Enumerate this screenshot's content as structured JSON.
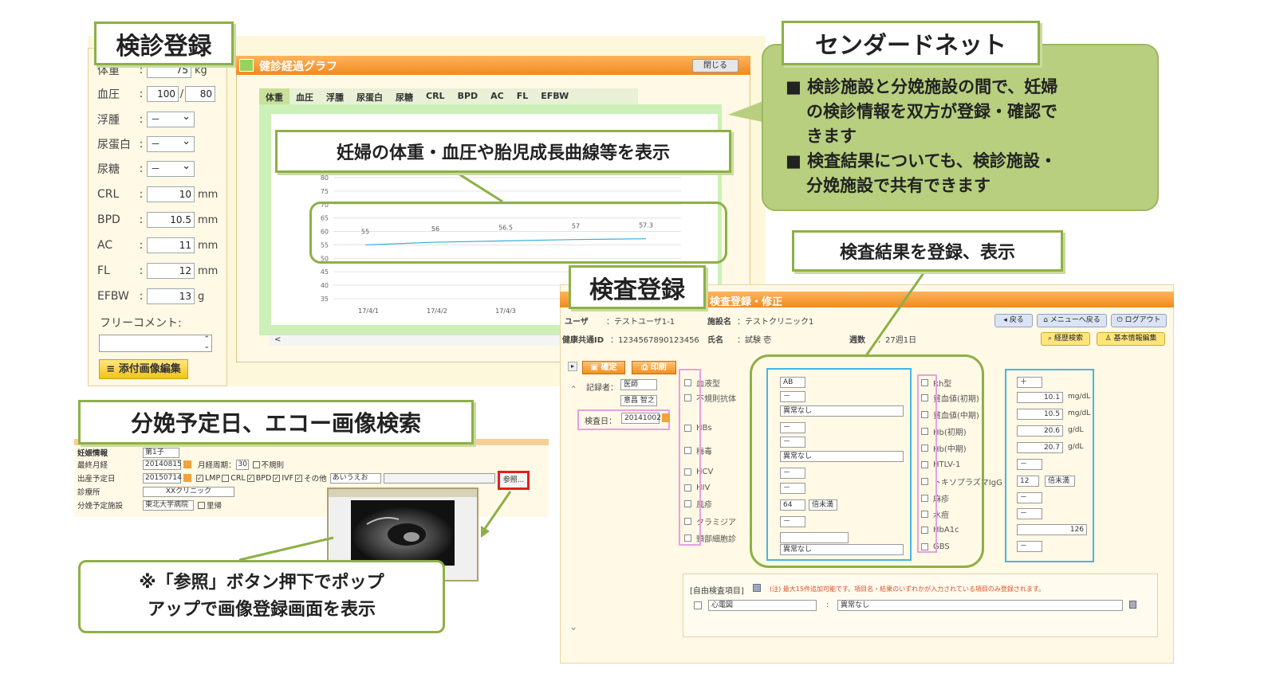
{
  "labels": {
    "exam_registration": "検診登録",
    "sender_net": "センダードネット",
    "delivery_search": "分娩予定日、エコー画像検索",
    "test_registration": "検査登録",
    "test_result_callout": "検査結果を登録、表示",
    "graph_callout": "妊婦の体重・血圧や胎児成長曲線等を表示",
    "popup_callout_line1": "※「参照」ボタン押下でポップ",
    "popup_callout_line2": "アップで画像登録画面を表示"
  },
  "sender_bubble": {
    "bullet1_line1": "■ 検診施設と分娩施設の間で、妊婦",
    "bullet1_line2": "の検診情報を双方が登録・確認で",
    "bullet1_line3": "きます",
    "bullet2_line1": "■ 検査結果についても、検診施設・",
    "bullet2_line2": "分娩施設で共有できます"
  },
  "exam_form": {
    "weight_label": "体重",
    "weight_value": "75",
    "weight_unit": "kg",
    "bp_label": "血圧",
    "bp_high": "100",
    "bp_sep": "/",
    "bp_low": "80",
    "edema_label": "浮腫",
    "edema_value": "－",
    "urine_protein_label": "尿蛋白",
    "urine_protein_value": "－",
    "urine_sugar_label": "尿糖",
    "urine_sugar_value": "－",
    "crl_label": "CRL",
    "crl_value": "10",
    "crl_unit": "mm",
    "bpd_label": "BPD",
    "bpd_value": "10.5",
    "bpd_unit": "mm",
    "ac_label": "AC",
    "ac_value": "11",
    "ac_unit": "mm",
    "fl_label": "FL",
    "fl_value": "12",
    "fl_unit": "mm",
    "efbw_label": "EFBW",
    "efbw_value": "13",
    "efbw_unit": "g",
    "colon": ":",
    "comment_label": "フリーコメント:",
    "attach_button": "添付画像編集"
  },
  "graph_window": {
    "title": "健診経過グラフ",
    "close_button": "閉じる",
    "tabs": [
      "体重",
      "血圧",
      "浮腫",
      "尿蛋白",
      "尿糖",
      "CRL",
      "BPD",
      "AC",
      "FL",
      "EFBW"
    ],
    "scroll_left": "<"
  },
  "chart_data": {
    "type": "line",
    "x": [
      "17/4/1",
      "17/4/2",
      "17/4/3"
    ],
    "series": [
      {
        "values": [
          55,
          56,
          56.5,
          57,
          57.3
        ]
      }
    ],
    "point_labels": [
      "55",
      "56",
      "56.5",
      "57",
      "57.3"
    ],
    "y_ticks": [
      35,
      40,
      45,
      50,
      55,
      60,
      65,
      70,
      75,
      80
    ],
    "ylim": [
      35,
      80
    ],
    "grid": true,
    "line_color": "#3aaed8"
  },
  "delivery_form": {
    "section_label": "妊娠情報",
    "section_value": "第1子",
    "lmp_label": "最終月経",
    "lmp_value": "20140815",
    "cycle_label": "月経周期：",
    "cycle_value": "30",
    "irregular_label": "不規則",
    "due_label": "出産予定日",
    "due_value": "20150714",
    "method_lmp": "LMP",
    "method_crl": "CRL",
    "method_bpd": "BPD",
    "method_ivf": "IVF",
    "method_other": "その他",
    "other_value": "あいうえお",
    "clinic_label": "診療所",
    "clinic_value": "XXクリニック",
    "facility_label": "分娩予定施設",
    "facility_value": "東北大学病院",
    "home_label": "里帰",
    "ref_button": "参照..."
  },
  "test_form": {
    "title": "検査登録・修正",
    "user_label": "ユーザ",
    "user_value": "：テストユーザ1-1",
    "facility_label": "施設名",
    "facility_value": "：テストクリニック1",
    "id_label": "健康共通ID",
    "id_value": "：1234567890123456",
    "name_label": "氏名",
    "name_value": "：試験 壱",
    "weeks_label": "週数",
    "weeks_value": "：27週1日",
    "btn_back": "戻る",
    "btn_menu": "メニューへ戻る",
    "btn_logout": "ログアウト",
    "btn_history": "経歴検索",
    "btn_basic": "基本情報編集",
    "btn_confirm": "確定",
    "btn_print": "印刷",
    "recorder_label": "記録者：",
    "recorder_role": "医師",
    "recorder_name": "意昌 智之",
    "date_label": "検査日：",
    "date_value": "20141002",
    "left_items": [
      "血液型",
      "不規則抗体",
      "HBs",
      "梅毒",
      "HCV",
      "HIV",
      "風疹",
      "クラミジア",
      "頸部細胞診"
    ],
    "right_items": [
      "Rh型",
      "貧血値(初期)",
      "貧血値(中期)",
      "Hb(初期)",
      "Hb(中期)",
      "HTLV-1",
      "トキソプラズマIgG",
      "麻疹",
      "水痘",
      "HbA1c",
      "GBS"
    ],
    "blood_type": "AB",
    "dash": "－",
    "abnormal_none": "異常なし",
    "rubella_value": "64",
    "rubella_unit": "倍未満",
    "rh_value": "＋",
    "anemia_early": "10.1",
    "anemia_mid": "10.5",
    "hb_early": "20.6",
    "hb_mid": "20.7",
    "toxo_value": "12",
    "toxo_unit": "倍未満",
    "hba1c_value": "126",
    "unit_mgdl": "mg/dL",
    "unit_gdl": "g/dL",
    "free_label": "[自由検査項目]",
    "free_note": "(注) 最大15件追加可能です。項目名・結果のいずれかが入力されている項目のみ登録されます。",
    "free_item": "心電図",
    "free_result": "異常なし"
  }
}
